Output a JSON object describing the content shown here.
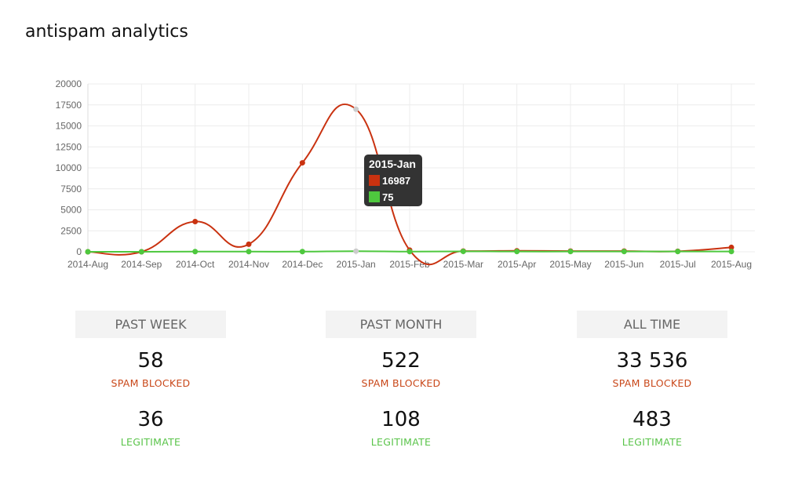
{
  "page": {
    "title": "antispam analytics"
  },
  "chart_data": {
    "type": "line",
    "title": "",
    "xlabel": "",
    "ylabel": "",
    "categories": [
      "2014-Aug",
      "2014-Sep",
      "2014-Oct",
      "2014-Nov",
      "2014-Dec",
      "2015-Jan",
      "2015-Feb",
      "2015-Mar",
      "2015-Apr",
      "2015-May",
      "2015-Jun",
      "2015-Jul",
      "2015-Aug"
    ],
    "ylim": [
      0,
      20000
    ],
    "yticks": [
      0,
      2500,
      5000,
      7500,
      10000,
      12500,
      15000,
      17500,
      20000
    ],
    "grid": true,
    "legend": "none",
    "series": [
      {
        "name": "spam",
        "color": "#c93210",
        "values": [
          0,
          0,
          3600,
          900,
          10600,
          16987,
          200,
          80,
          120,
          80,
          80,
          60,
          522
        ]
      },
      {
        "name": "legitimate",
        "color": "#4ec83e",
        "values": [
          0,
          0,
          20,
          20,
          20,
          75,
          20,
          50,
          30,
          30,
          30,
          30,
          30
        ]
      }
    ],
    "highlight_index": 5,
    "tooltip": {
      "title": "2015-Jan",
      "rows": [
        {
          "color": "#c93210",
          "value": "16987"
        },
        {
          "color": "#4ec83e",
          "value": "75"
        }
      ]
    }
  },
  "stats": [
    {
      "period": "PAST WEEK",
      "spam": "58",
      "spam_label": "SPAM BLOCKED",
      "legit": "36",
      "legit_label": "LEGITIMATE"
    },
    {
      "period": "PAST MONTH",
      "spam": "522",
      "spam_label": "SPAM BLOCKED",
      "legit": "108",
      "legit_label": "LEGITIMATE"
    },
    {
      "period": "ALL TIME",
      "spam": "33 536",
      "spam_label": "SPAM BLOCKED",
      "legit": "483",
      "legit_label": "LEGITIMATE"
    }
  ]
}
